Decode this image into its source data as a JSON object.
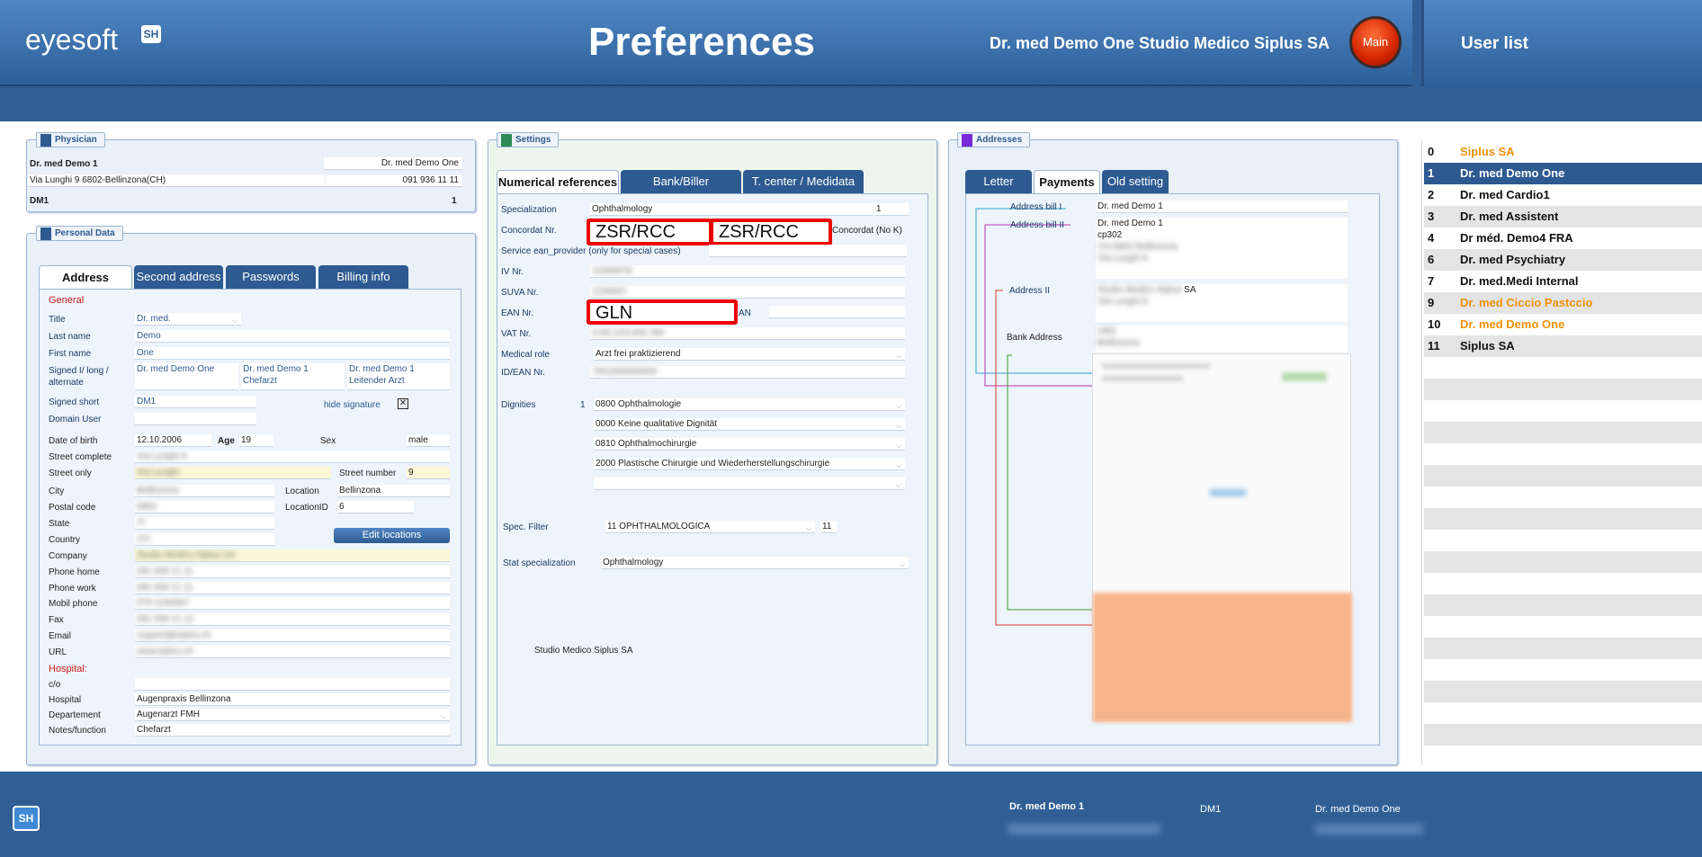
{
  "header": {
    "logo_text": "eyesoft",
    "logo_badge": "SH",
    "title": "Preferences",
    "doctor": "Dr. med Demo One  Studio Medico Siplus SA",
    "main_button": "Main",
    "user_list_title": "User list"
  },
  "physician": {
    "section_title": "Physician",
    "name_left": "Dr. med Demo 1",
    "name_right": "Dr. med Demo One",
    "address": "Via Lunghi 9 6802-Bellinzona(CH)",
    "phone": "091 936 11 11",
    "code": "DM1",
    "code_num": "1"
  },
  "personal": {
    "section_title": "Personal Data",
    "tabs": [
      "Address",
      "Second address",
      "Passwords",
      "Billing info"
    ],
    "general_label": "General",
    "title_label": "Title",
    "title_value": "Dr. med.",
    "last_name_label": "Last name",
    "last_name_value": "Demo",
    "first_name_label": "First name",
    "first_name_value": "One",
    "signed_label": "Signed I/ long / alternate",
    "signed_1": "Dr. med Demo One",
    "signed_2": "Dr. med Demo 1 Chefarzt",
    "signed_3": "Dr. med Demo 1 Leitender Arzt",
    "signed_short_label": "Signed short",
    "signed_short_value": "DM1",
    "hide_signature": "hide signature",
    "domain_user_label": "Domain User",
    "dob_label": "Date of birth",
    "dob_value": "12.10.2006",
    "age_label": "Age",
    "age_value": "19",
    "sex_label": "Sex",
    "sex_value": "male",
    "street_complete_label": "Street complete",
    "street_only_label": "Street only",
    "street_number_label": "Street number",
    "street_number_value": "9",
    "city_label": "City",
    "location_label": "Location",
    "location_value": "Bellinzona",
    "postal_label": "Postal code",
    "location_id_label": "LocationID",
    "location_id_value": "6",
    "state_label": "State",
    "country_label": "Country",
    "edit_locations": "Edit locations",
    "company_label": "Company",
    "phone_home_label": "Phone home",
    "phone_work_label": "Phone work",
    "mobil_label": "Mobil phone",
    "fax_label": "Fax",
    "email_label": "Email",
    "url_label": "URL",
    "hospital_section": "Hospital:",
    "co_label": "c/o",
    "hospital_label": "Hospital",
    "hospital_value": "Augenpraxis Bellinzona",
    "department_label": "Departement",
    "department_value": "Augenarzt FMH",
    "notes_label": "Notes/function",
    "notes_value": "Chefarzt"
  },
  "settings": {
    "section_title": "Settings",
    "tabs": [
      "Numerical references",
      "Bank/Biller",
      "T. center / Medidata"
    ],
    "specialization_label": "Specialization",
    "specialization_value": "Ophthalmology",
    "specialization_num": "1",
    "concordat_label": "Concordat Nr.",
    "zsr_1": "ZSR/RCC",
    "zsr_2": "ZSR/RCC",
    "concordat_nok": "Concordat (No K)",
    "service_ean": "Service ean_provider (only for special cases)",
    "iv_label": "IV Nr.",
    "suva_label": "SUVA Nr.",
    "ean_label": "EAN Nr.",
    "gln": "GLN",
    "an_label": "AN",
    "vat_label": "VAT Nr.",
    "medical_role_label": "Medical role",
    "medical_role_value": "Arzt frei praktizierend",
    "id_ean_label": "ID/EAN Nr.",
    "dignities_label": "Dignities",
    "dignities_num": "1",
    "dignities": [
      "0800 Ophthalmologie",
      "0000 Keine qualitative Dignität",
      "0810 Ophthalmochirurgie",
      "2000 Plastische Chirurgie und Wiederherstellungschirurgie",
      ""
    ],
    "spec_filter_label": "Spec. Filter",
    "spec_filter_value": "11 OPHTHALMOLOGICA",
    "spec_filter_num": "11",
    "stat_spec_label": "Stat specialization",
    "stat_spec_value": "Ophthalmology",
    "studio": "Studio Medico Siplus SA"
  },
  "addresses": {
    "section_title": "Addresses",
    "tabs": [
      "Letter",
      "Payments",
      "Old setting"
    ],
    "address_bill_1_label": "Address bill I",
    "address_bill_1_value": "Dr. med Demo 1",
    "address_bill_2_label": "Address bill II",
    "address_bill_2_line1": "Dr. med Demo 1",
    "address_bill_2_line2": "cp302",
    "address_2_label": "Address II",
    "address_2_suffix": "SA",
    "bank_address_label": "Bank Address"
  },
  "user_list": [
    {
      "num": "0",
      "name": "Siplus SA",
      "color": "#f0900a"
    },
    {
      "num": "1",
      "name": "Dr. med Demo One",
      "color": "#ffffff"
    },
    {
      "num": "2",
      "name": "Dr. med Cardio1",
      "color": "#111111"
    },
    {
      "num": "3",
      "name": "Dr. med Assistent",
      "color": "#111111"
    },
    {
      "num": "4",
      "name": "Dr méd. Demo4 FRA",
      "color": "#111111"
    },
    {
      "num": "6",
      "name": "Dr. med Psychiatry",
      "color": "#111111"
    },
    {
      "num": "7",
      "name": "Dr. med.Medi Internal",
      "color": "#111111"
    },
    {
      "num": "9",
      "name": "Dr. med Ciccio Pastccio",
      "color": "#f0900a"
    },
    {
      "num": "10",
      "name": "Dr. med Demo One",
      "color": "#f0900a"
    },
    {
      "num": "11",
      "name": "Siplus SA",
      "color": "#111111"
    }
  ],
  "footer": {
    "badge": "SH",
    "name": "Dr. med Demo 1",
    "code": "DM1",
    "name_right": "Dr. med Demo One"
  },
  "colors": {
    "header_blue": "#2f5f95",
    "selected_row": "#2d5a90",
    "highlight_red": "#ee0000",
    "orange_user": "#f0900a"
  }
}
